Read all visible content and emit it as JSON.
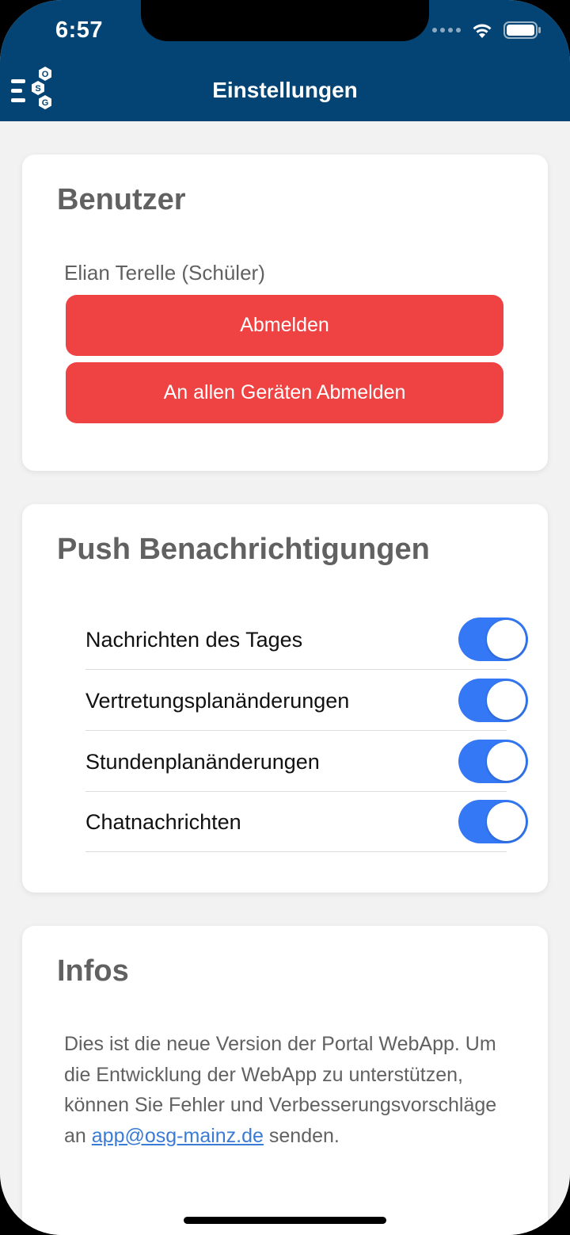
{
  "status_bar": {
    "time": "6:57"
  },
  "header": {
    "title": "Einstellungen",
    "logo_letters": [
      "O",
      "S",
      "G"
    ]
  },
  "user_card": {
    "title": "Benutzer",
    "user_name": "Elian Terelle (Schüler)",
    "logout_label": "Abmelden",
    "logout_all_label": "An allen Geräten Abmelden"
  },
  "push_card": {
    "title": "Push Benachrichtigungen",
    "toggles": [
      {
        "label": "Nachrichten des Tages",
        "on": true
      },
      {
        "label": "Vertretungsplanänderungen",
        "on": true
      },
      {
        "label": "Stundenplanänderungen",
        "on": true
      },
      {
        "label": "Chatnachrichten",
        "on": true
      }
    ]
  },
  "info_card": {
    "title": "Infos",
    "text_before": "Dies ist die neue Version der Portal WebApp. Um die Entwicklung der WebApp zu unterstützen, können Sie Fehler und Verbesserungsvorschläge an ",
    "link": "app@osg-mainz.de",
    "text_after": " senden."
  },
  "colors": {
    "header": "#034474",
    "danger": "#ef4242",
    "toggle_on": "#3478f6"
  }
}
